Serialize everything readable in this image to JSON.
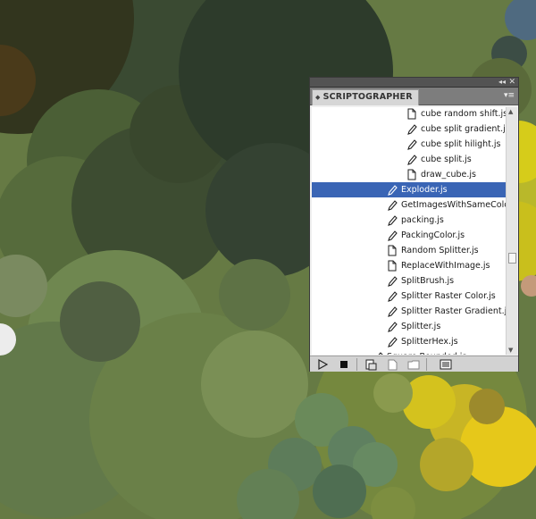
{
  "panel": {
    "title": "SCRIPTOGRAPHER",
    "collapse_icon": "double-chevron-left-icon",
    "close_icon": "close-icon",
    "menu_icon": "panel-menu-icon"
  },
  "script_list": [
    {
      "label": "cube random shift.js",
      "icon": "document-icon",
      "selected": false
    },
    {
      "label": "cube split gradient.js",
      "icon": "pencil-icon",
      "selected": false
    },
    {
      "label": "cube split hilight.js",
      "icon": "pencil-icon",
      "selected": false
    },
    {
      "label": "cube split.js",
      "icon": "pencil-icon",
      "selected": false
    },
    {
      "label": "draw_cube.js",
      "icon": "document-icon",
      "selected": false
    },
    {
      "label": "Exploder.js",
      "icon": "pencil-icon",
      "selected": true
    },
    {
      "label": "GetImagesWithSameColo",
      "icon": "pencil-icon",
      "selected": false
    },
    {
      "label": "packing.js",
      "icon": "pencil-icon",
      "selected": false
    },
    {
      "label": "PackingColor.js",
      "icon": "pencil-icon",
      "selected": false
    },
    {
      "label": "Random Splitter.js",
      "icon": "document-icon",
      "selected": false
    },
    {
      "label": "ReplaceWithImage.js",
      "icon": "document-icon",
      "selected": false
    },
    {
      "label": "SplitBrush.js",
      "icon": "pencil-icon",
      "selected": false
    },
    {
      "label": "Splitter Raster Color.js",
      "icon": "pencil-icon",
      "selected": false
    },
    {
      "label": "Splitter Raster Gradient.js",
      "icon": "pencil-icon",
      "selected": false
    },
    {
      "label": "Splitter.js",
      "icon": "pencil-icon",
      "selected": false
    },
    {
      "label": "SplitterHex.js",
      "icon": "pencil-icon",
      "selected": false
    },
    {
      "label": "Square Bounded.js",
      "icon": "pencil-icon",
      "selected": false
    }
  ],
  "toolbar": {
    "buttons": [
      "play-icon",
      "stop-icon",
      "new-script-icon",
      "new-file-icon",
      "folder-icon",
      "console-icon"
    ]
  },
  "colors": {
    "selection": "#3a65b5",
    "panel_background": "#f0f0f0"
  }
}
